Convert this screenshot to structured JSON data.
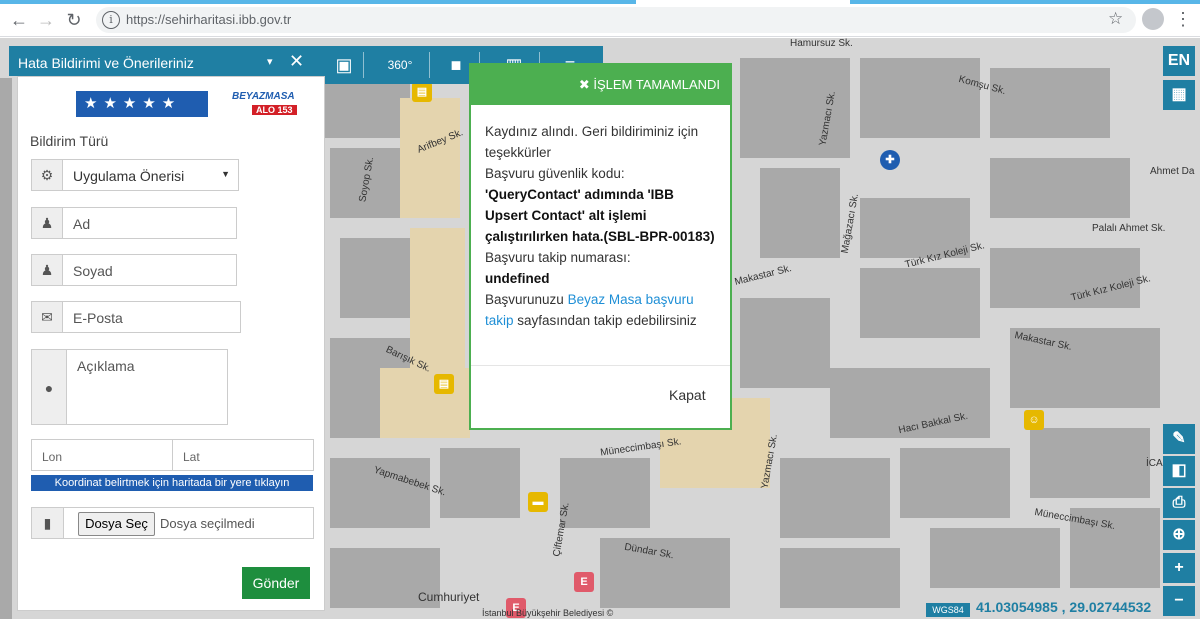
{
  "browser": {
    "url": "https://sehirharitasi.ibb.gov.tr",
    "back_icon": "←",
    "forward_icon": "→",
    "reload_icon": "↻",
    "info_icon": "i",
    "star_icon": "☆",
    "menu_icon": "⋮"
  },
  "toolbar": {
    "items": [
      "tram-icon",
      "360-icon",
      "camera-icon",
      "map-icon",
      "menu-icon"
    ],
    "pano_label": "360°"
  },
  "right_bar": {
    "lang": "EN",
    "traffic_icon": "▦",
    "zoom_in": "+",
    "zoom_out": "−",
    "locate_icon": "⊕"
  },
  "panel": {
    "title": "Hata Bildirimi ve Önerileriniz",
    "close": "✕",
    "collapse": "▾",
    "stars": "★★★★★",
    "logo_top": "BEYAZMASA",
    "logo_bottom": "ALO 153",
    "type_label": "Bildirim Türü",
    "type_value": "Uygulama Önerisi",
    "name_placeholder": "Ad",
    "surname_placeholder": "Soyad",
    "email_placeholder": "E-Posta",
    "desc_placeholder": "Açıklama",
    "lon_placeholder": "Lon",
    "lat_placeholder": "Lat",
    "coord_hint": "Koordinat belirtmek için haritada bir yere tıklayın",
    "file_button": "Dosya Seç",
    "file_text": "Dosya seçilmedi",
    "submit": "Gönder"
  },
  "modal": {
    "title": "İŞLEM TAMAMLANDI",
    "close_icon": "✖",
    "line1": "Kaydınız alındı. Geri bildiriminiz için teşekkürler",
    "line2": "Başvuru güvenlik kodu:",
    "error": "'QueryContact' adımında 'IBB Upsert Contact' alt işlemi çalıştırılırken hata.(SBL-BPR-00183)",
    "line3": "Başvuru takip numarası:",
    "tracking": "undefined",
    "line4_pre": "Başvurunuzu ",
    "line4_link": "Beyaz Masa başvuru takip",
    "line4_post": " sayfasından takip edebilirsiniz",
    "close_button": "Kapat"
  },
  "map": {
    "streets": [
      "Hamursuz Sk.",
      "Komşu Sk.",
      "Arifbey Sk.",
      "Soyop Sk.",
      "Yazmacı Sk.",
      "Mağazacı Sk.",
      "Ahmet Da",
      "Palalı Ahmet Sk.",
      "Türk Kız Koleji Sk.",
      "Türk Kız Koleji Sk.",
      "Makastar Sk.",
      "Makastar Sk.",
      "Barışık Sk.",
      "Yapmabebek Sk.",
      "Müneccimbaşı Sk.",
      "Hacı Bakkal Sk.",
      "Müneccimbaşı Sk.",
      "Dündar Sk.",
      "Çiftemar Sk.",
      "Yazmacı Sk.",
      "Cumhuriyet",
      "İCA"
    ],
    "copyright": "İstanbul Büyükşehir Belediyesi ©",
    "datum": "WGS84",
    "coords": "41.03054985 , 29.02744532"
  }
}
